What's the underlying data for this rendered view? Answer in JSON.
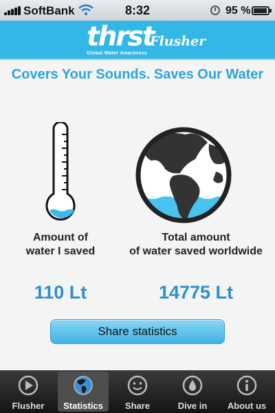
{
  "status_bar": {
    "carrier": "SoftBank",
    "time": "8:32",
    "battery": "95 %"
  },
  "header": {
    "logo": "thrst",
    "subtitle": "Global Water Awareness",
    "app_name": "Flusher"
  },
  "tagline": "Covers Your Sounds. Saves Our Water",
  "stats": {
    "mine": {
      "label_line1": "Amount of",
      "label_line2": "water I saved",
      "value": "110 Lt"
    },
    "world": {
      "label_line1": "Total amount",
      "label_line2": "of water saved worldwide",
      "value": "14775 Lt"
    }
  },
  "share_button": "Share statistics",
  "tabs": [
    {
      "label": "Flusher",
      "icon": "play-icon"
    },
    {
      "label": "Statistics",
      "icon": "globe-icon",
      "active": true
    },
    {
      "label": "Share",
      "icon": "smiley-icon"
    },
    {
      "label": "Dive in",
      "icon": "water-drop-icon"
    },
    {
      "label": "About us",
      "icon": "info-icon"
    }
  ],
  "colors": {
    "accent": "#33b7e6",
    "value_blue": "#2d8fcc",
    "tabbar": "#1e1e1e"
  }
}
